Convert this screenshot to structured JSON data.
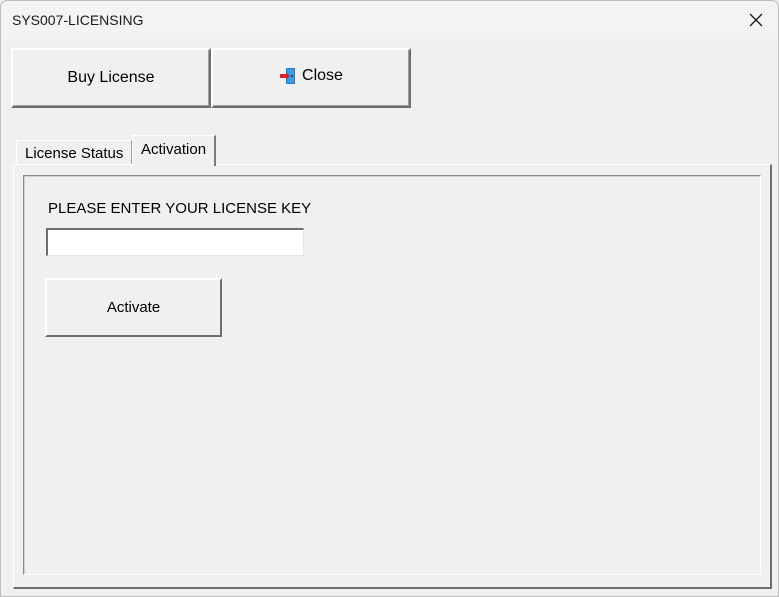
{
  "window": {
    "title": "SYS007-LICENSING"
  },
  "toolbar": {
    "buy_label": "Buy License",
    "close_label": "Close",
    "close_icon": "door-exit-icon"
  },
  "tabs": [
    {
      "label": "License Status",
      "active": false
    },
    {
      "label": "Activation",
      "active": true
    }
  ],
  "activation": {
    "prompt": "PLEASE ENTER YOUR LICENSE KEY",
    "key_value": "",
    "activate_label": "Activate"
  },
  "colors": {
    "face": "#f0f0f0",
    "shadow": "#6e6e6e",
    "highlight": "#ffffff",
    "door_icon_blue": "#1f7fd1",
    "door_icon_red": "#d8232a"
  }
}
